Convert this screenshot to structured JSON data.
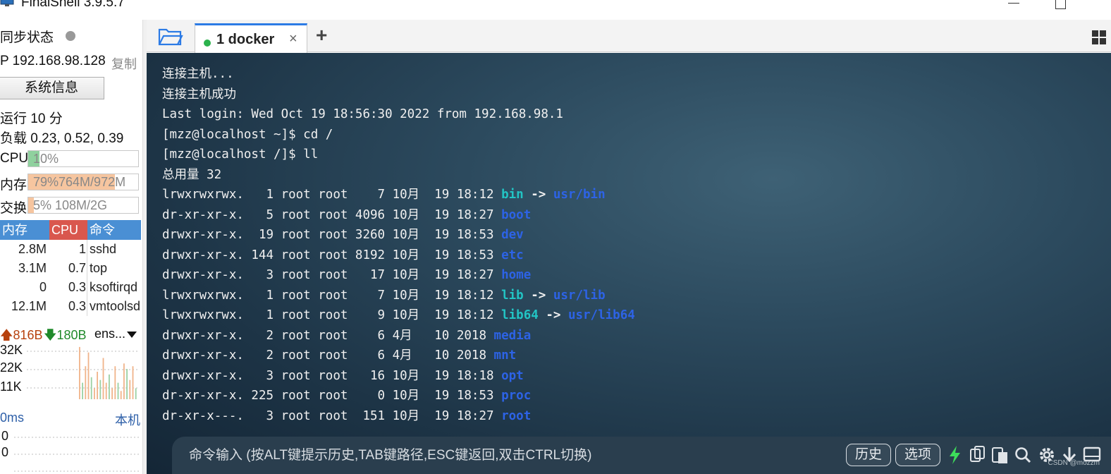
{
  "window": {
    "title": "FinalShell 3.9.5.7"
  },
  "sidebar": {
    "sync_label": "同步状态",
    "ip_label": "P 192.168.98.128",
    "copy_label": "复制",
    "sysinfo_button": "系统信息",
    "uptime": "运行 10 分",
    "load": "负载 0.23, 0.52, 0.39",
    "cpu": {
      "label": "CPU",
      "text": "10%",
      "percent": 10
    },
    "memory": {
      "label": "内存",
      "text": "79%764M/972M",
      "percent": 79
    },
    "swap": {
      "label": "交换",
      "text": "5%     108M/2G",
      "percent": 5
    },
    "process_table": {
      "headers": [
        "内存",
        "CPU",
        "命令"
      ],
      "rows": [
        {
          "mem": "2.8M",
          "cpu": "1",
          "cmd": "sshd"
        },
        {
          "mem": "3.1M",
          "cpu": "0.7",
          "cmd": "top"
        },
        {
          "mem": "0",
          "cpu": "0.3",
          "cmd": "ksoftirqd"
        },
        {
          "mem": "12.1M",
          "cpu": "0.3",
          "cmd": "vmtoolsd"
        }
      ]
    },
    "network": {
      "up": "816B",
      "down": "180B",
      "iface": "ens...",
      "y_labels": [
        "32K",
        "22K",
        "11K"
      ],
      "bars": [
        0.95,
        0.3,
        0.6,
        0.85,
        0.4,
        0.2,
        0.5,
        0.35,
        0.75,
        0.3,
        0.45,
        0.2,
        0.6,
        0.3,
        0.15,
        0.65,
        0.55,
        0.35,
        0.6,
        0.2
      ]
    },
    "latency": {
      "left": "0ms",
      "right": "本机",
      "values": [
        "0",
        "0"
      ]
    }
  },
  "tabs": [
    {
      "label": "1 docker",
      "status_color": "#2bb24c"
    }
  ],
  "terminal": {
    "lines": [
      [
        {
          "t": "连接主机..."
        }
      ],
      [
        {
          "t": "连接主机成功"
        }
      ],
      [
        {
          "t": "Last login: Wed Oct 19 18:56:30 2022 from 192.168.98.1"
        }
      ],
      [
        {
          "t": "[mzz@localhost ~]$ cd /"
        }
      ],
      [
        {
          "t": "[mzz@localhost /]$ ll"
        }
      ],
      [
        {
          "t": "总用量 32"
        }
      ],
      [
        {
          "t": "lrwxrwxrwx.   1 root root    7 10月  19 18:12 "
        },
        {
          "t": "bin",
          "c": "cyan"
        },
        {
          "t": " -> ",
          "c": "white"
        },
        {
          "t": "usr/bin",
          "c": "blue"
        }
      ],
      [
        {
          "t": "dr-xr-xr-x.   5 root root 4096 10月  19 18:27 "
        },
        {
          "t": "boot",
          "c": "blue"
        }
      ],
      [
        {
          "t": "drwxr-xr-x.  19 root root 3260 10月  19 18:53 "
        },
        {
          "t": "dev",
          "c": "blue"
        }
      ],
      [
        {
          "t": "drwxr-xr-x. 144 root root 8192 10月  19 18:53 "
        },
        {
          "t": "etc",
          "c": "blue"
        }
      ],
      [
        {
          "t": "drwxr-xr-x.   3 root root   17 10月  19 18:27 "
        },
        {
          "t": "home",
          "c": "blue"
        }
      ],
      [
        {
          "t": "lrwxrwxrwx.   1 root root    7 10月  19 18:12 "
        },
        {
          "t": "lib",
          "c": "cyan"
        },
        {
          "t": " -> ",
          "c": "white"
        },
        {
          "t": "usr/lib",
          "c": "blue"
        }
      ],
      [
        {
          "t": "lrwxrwxrwx.   1 root root    9 10月  19 18:12 "
        },
        {
          "t": "lib64",
          "c": "cyan"
        },
        {
          "t": " -> ",
          "c": "white"
        },
        {
          "t": "usr/lib64",
          "c": "blue"
        }
      ],
      [
        {
          "t": "drwxr-xr-x.   2 root root    6 4月   10 2018 "
        },
        {
          "t": "media",
          "c": "blue"
        }
      ],
      [
        {
          "t": "drwxr-xr-x.   2 root root    6 4月   10 2018 "
        },
        {
          "t": "mnt",
          "c": "blue"
        }
      ],
      [
        {
          "t": "drwxr-xr-x.   3 root root   16 10月  19 18:18 "
        },
        {
          "t": "opt",
          "c": "blue"
        }
      ],
      [
        {
          "t": "dr-xr-xr-x. 225 root root    0 10月  19 18:53 "
        },
        {
          "t": "proc",
          "c": "blue"
        }
      ],
      [
        {
          "t": "dr-xr-x---.   3 root root  151 10月  19 18:27 "
        },
        {
          "t": "root",
          "c": "blue"
        }
      ]
    ]
  },
  "command_bar": {
    "placeholder": "命令输入 (按ALT键提示历史,TAB键路径,ESC键返回,双击CTRL切换)",
    "history_button": "历史",
    "options_button": "选项"
  },
  "watermark": "CSDN @mozzm",
  "colors": {
    "accent_blue": "#2c7be5",
    "status_green": "#2bb24c",
    "dir_blue": "#2d63e6",
    "link_cyan": "#22c4c4",
    "cpu_header_red": "#d9574e"
  }
}
